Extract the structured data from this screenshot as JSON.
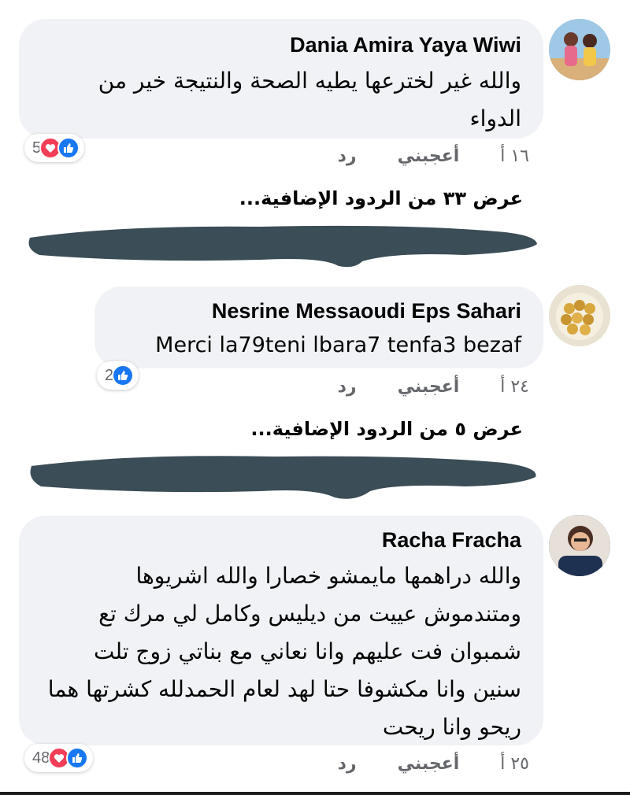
{
  "comments": [
    {
      "author": "Dania Amira Yaya Wiwi",
      "text": "والله غير لخترعها يطيه الصحة والنتيجة خير من الدواء",
      "reaction_count": "5",
      "time": "١٦ أ",
      "like_label": "أعجبني",
      "reply_label": "رد"
    },
    {
      "author": "Nesrine Messaoudi Eps Sahari",
      "text": "Merci la79teni lbara7 tenfa3 bezaf",
      "reaction_count": "2",
      "time": "٢٤ أ",
      "like_label": "أعجبني",
      "reply_label": "رد"
    },
    {
      "author": "Racha Fracha",
      "text": "والله دراهمها مايمشو خصارا والله اشريوها ومتندموش عييت من ديليس وكامل لي مرك تع شمبوان فت عليهم وانا نعاني مع بناتي زوج تلت سنين وانا مكشوفا حتا لهد لعام الحمدلله كشرتها هما ريحو وانا ريحت",
      "reaction_count": "48",
      "time": "٢٥ أ",
      "like_label": "أعجبني",
      "reply_label": "رد"
    }
  ],
  "more_replies": [
    "عرض ٣٣ من الردود الإضافية...",
    "عرض ٥ من الردود الإضافية..."
  ],
  "colors": {
    "bubble": "#f0f2f5",
    "like": "#1877f2",
    "love": "#f33e58",
    "redaction": "#3b4d56"
  }
}
